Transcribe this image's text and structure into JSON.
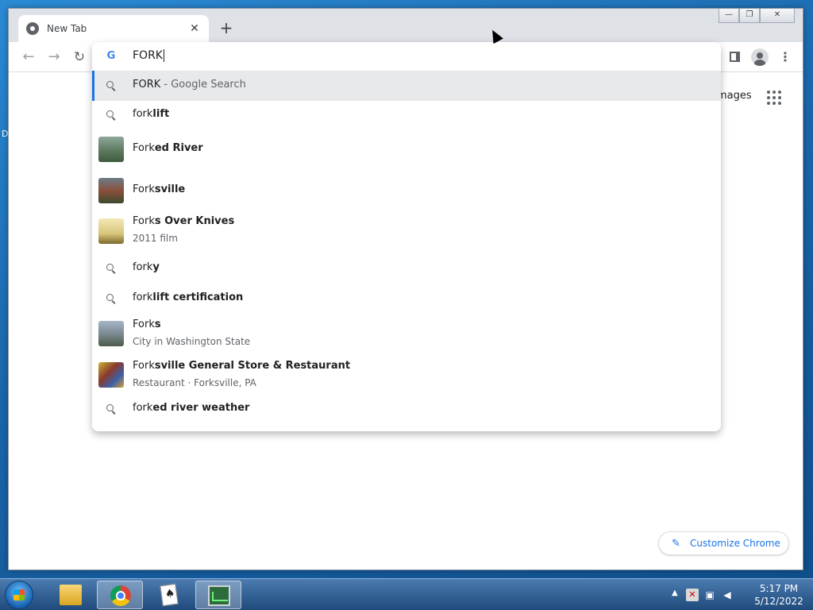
{
  "desktop": {
    "edge_letter": "D"
  },
  "browser": {
    "tab": {
      "title": "New Tab"
    },
    "new_tab_label": "+",
    "window_controls": {
      "minimize": "—",
      "restore": "❐",
      "close": "✕"
    },
    "toolbar": {
      "back": "←",
      "forward": "→",
      "reload": "↻",
      "menu": "⋮"
    },
    "omnibox": {
      "value": "FORK",
      "suggestions": [
        {
          "type": "search",
          "plain": "FORK",
          "bold": "",
          "suffix": " - Google Search",
          "selected": true
        },
        {
          "type": "search",
          "plain": "fork",
          "bold": "lift"
        },
        {
          "type": "entity",
          "plain": "Fork",
          "bold": "ed River",
          "thumb": "river"
        },
        {
          "type": "entity",
          "plain": "Fork",
          "bold": "sville",
          "thumb": "forksville"
        },
        {
          "type": "entity",
          "plain": "Fork",
          "bold": "s Over Knives",
          "sub": "2011 film",
          "thumb": "poster"
        },
        {
          "type": "search",
          "plain": "fork",
          "bold": "y"
        },
        {
          "type": "search",
          "plain": "fork",
          "bold": "lift certification"
        },
        {
          "type": "entity",
          "plain": "Fork",
          "bold": "s",
          "sub": "City in Washington State",
          "thumb": "town"
        },
        {
          "type": "entity",
          "plain": "Fork",
          "bold": "sville General Store & Restaurant",
          "sub": "Restaurant · Forksville, PA",
          "thumb": "store"
        },
        {
          "type": "search",
          "plain": "fork",
          "bold": "ed river weather"
        }
      ]
    },
    "ntp": {
      "images_link": "mages",
      "customize_label": "Customize Chrome"
    }
  },
  "taskbar": {
    "clock_time": "5:17 PM",
    "clock_date": "5/12/2022",
    "tray_arrow": "▲"
  }
}
